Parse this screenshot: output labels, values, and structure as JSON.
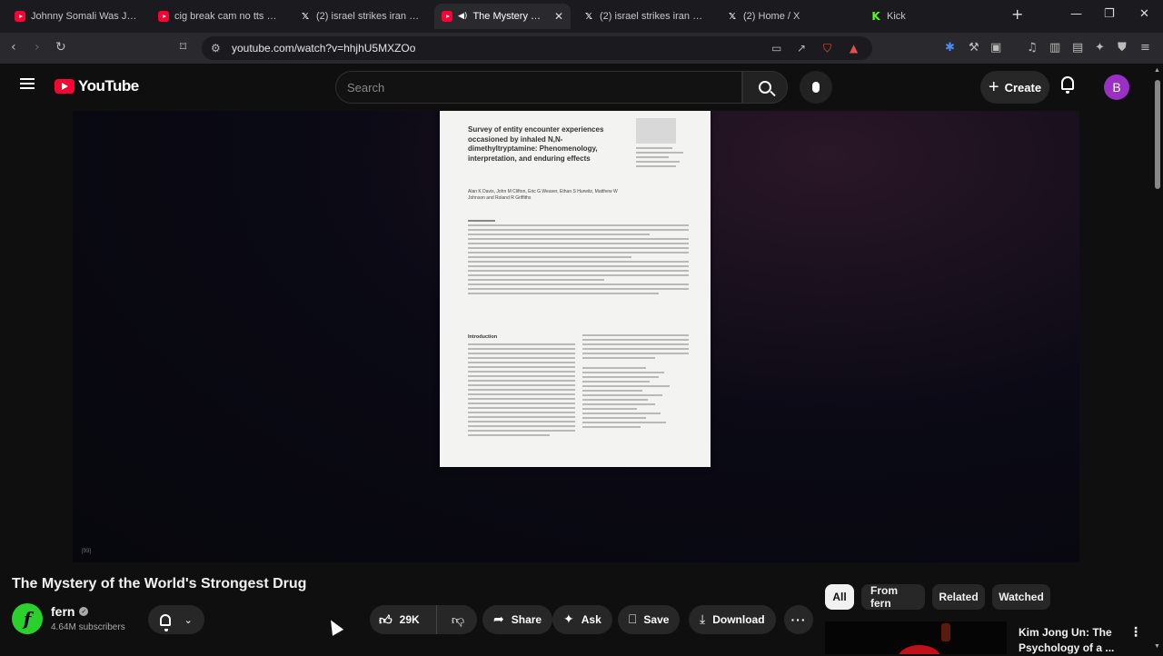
{
  "browser": {
    "tabs": [
      {
        "title": "Johnny Somali Was Just D",
        "icon": "youtube-icon",
        "active": false
      },
      {
        "title": "cig break cam no tts - You",
        "icon": "youtube-icon",
        "active": false
      },
      {
        "title": "(2) israel strikes iran - Sear",
        "icon": "x-icon",
        "active": false
      },
      {
        "title": "The Mystery of the",
        "icon": "youtube-icon",
        "active": true
      },
      {
        "title": "(2) israel strikes iran - Sear",
        "icon": "x-icon",
        "active": false
      },
      {
        "title": "(2) Home / X",
        "icon": "x-icon",
        "active": false
      },
      {
        "title": "Kick",
        "icon": "kick-icon",
        "active": false
      }
    ],
    "url": "youtube.com/watch?v=hhjhU5MXZOo"
  },
  "header": {
    "logo_text": "YouTube",
    "search_placeholder": "Search",
    "create_label": "Create",
    "avatar_letter": "B"
  },
  "video": {
    "paper_title": "Survey of entity encounter experiences occasioned by inhaled N,N-dimethyltryptamine: Phenomenology, interpretation, and enduring effects",
    "paper_authors": "Alan K Davis, John M Clifton, Eric G Weaver, Ethan S Hurwitz, Matthew W Johnson and Roland R Griffiths",
    "paper_section": "Introduction",
    "frame_tag": "[93]"
  },
  "meta": {
    "title": "The Mystery of the World's Strongest Drug",
    "channel": "fern",
    "subscribers": "4.64M subscribers",
    "likes": "29K",
    "share_label": "Share",
    "ask_label": "Ask",
    "save_label": "Save",
    "download_label": "Download"
  },
  "filters": [
    "All",
    "From fern",
    "Related",
    "Watched"
  ],
  "recommendation": {
    "title": "Kim Jong Un: The Psychology of a ..."
  },
  "colors": {
    "brand_red": "#ff0033",
    "avatar_purple": "#9a2fc4",
    "channel_green": "#2bd12b"
  }
}
